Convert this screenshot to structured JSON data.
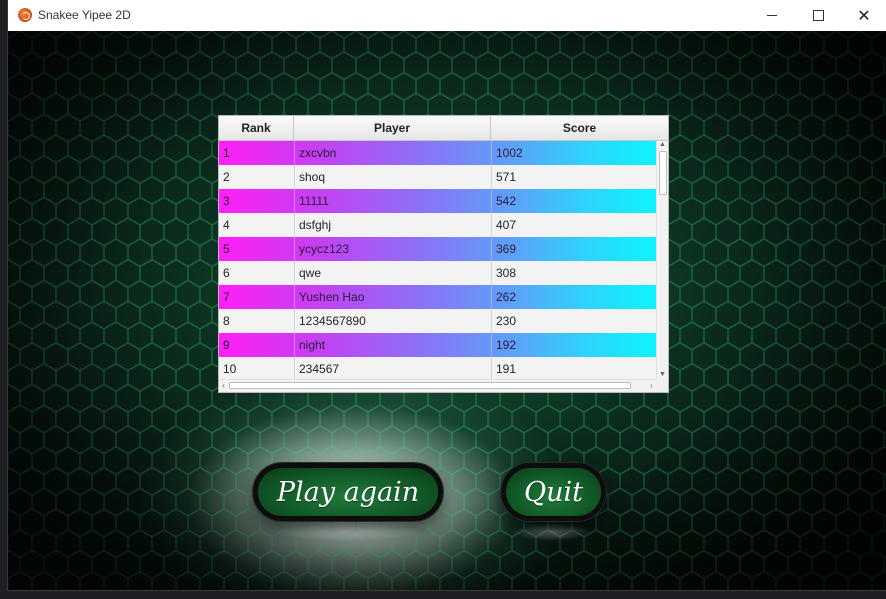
{
  "window": {
    "title": "Snakee Yipee 2D",
    "minimize_glyph": "—",
    "maximize_glyph": "☐",
    "close_glyph": "✕"
  },
  "table": {
    "headers": {
      "rank": "Rank",
      "player": "Player",
      "score": "Score"
    },
    "rows": [
      {
        "rank": "1",
        "player": "zxcvbn",
        "score": "1002",
        "highlight": true
      },
      {
        "rank": "2",
        "player": "shoq",
        "score": "571",
        "highlight": false
      },
      {
        "rank": "3",
        "player": "11111",
        "score": "542",
        "highlight": true
      },
      {
        "rank": "4",
        "player": "dsfghj",
        "score": "407",
        "highlight": false
      },
      {
        "rank": "5",
        "player": "ycycz123",
        "score": "369",
        "highlight": true
      },
      {
        "rank": "6",
        "player": "qwe",
        "score": "308",
        "highlight": false
      },
      {
        "rank": "7",
        "player": "Yushen Hao",
        "score": "262",
        "highlight": true
      },
      {
        "rank": "8",
        "player": "1234567890",
        "score": "230",
        "highlight": false
      },
      {
        "rank": "9",
        "player": "night",
        "score": "192",
        "highlight": true
      },
      {
        "rank": "10",
        "player": "234567",
        "score": "191",
        "highlight": false
      }
    ]
  },
  "buttons": {
    "play_again": "Play again",
    "quit": "Quit"
  },
  "colors": {
    "highlight_start": "#ff1ff6",
    "highlight_end": "#0ef4fd",
    "button_fill": "#1f7a3a",
    "background": "#07130d"
  },
  "icons": {
    "app": "snake-app-icon"
  }
}
